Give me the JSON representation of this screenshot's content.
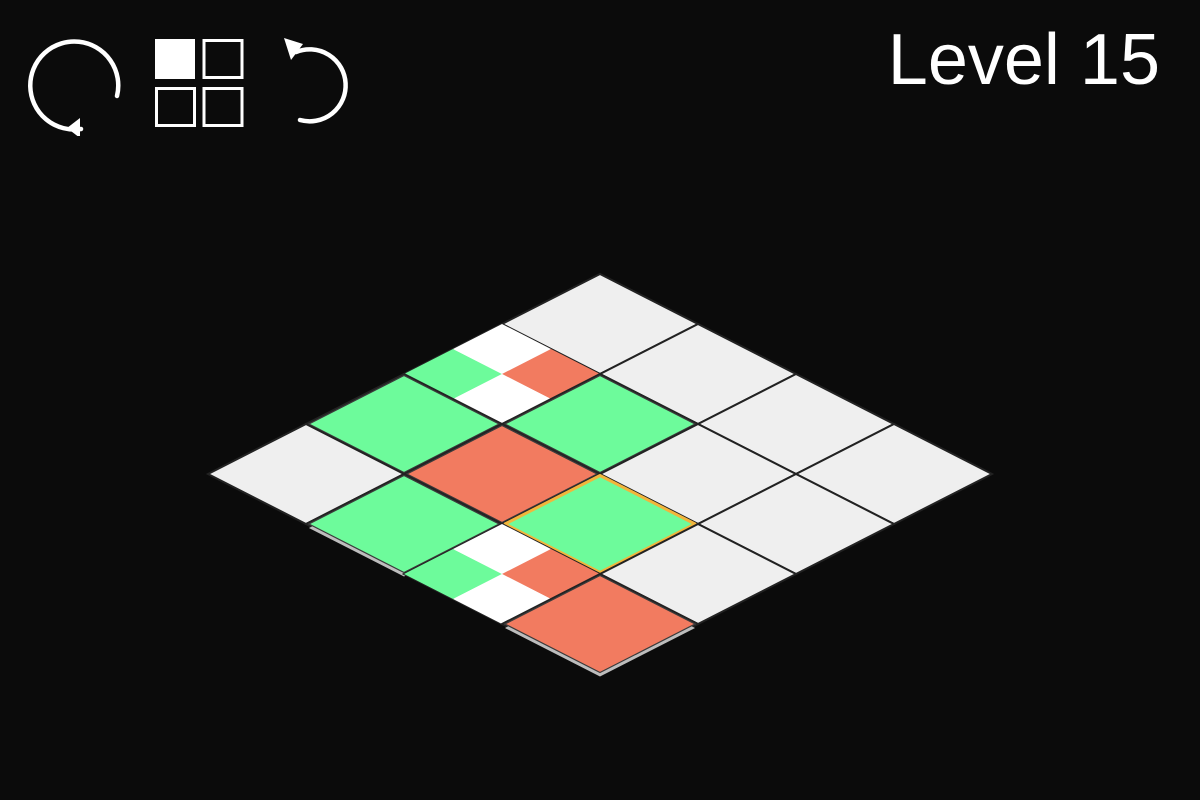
{
  "header": {
    "level_label": "Level 15"
  },
  "toolbar": {
    "restart_icon": "restart-icon",
    "levels_icon": "level-grid-icon",
    "undo_icon": "undo-icon"
  },
  "colors": {
    "background": "#0b0b0b",
    "empty_tile": "#efefef",
    "green": "#6dfb9b",
    "red": "#f27b60",
    "white": "#ffffff",
    "tile_line": "#222222",
    "selection_outline": "#f2b53c",
    "icon": "#ffffff"
  },
  "board": {
    "size": 4,
    "cells": [
      {
        "row": 0,
        "col": 0,
        "type": "empty"
      },
      {
        "row": 0,
        "col": 1,
        "type": "empty"
      },
      {
        "row": 0,
        "col": 2,
        "type": "empty"
      },
      {
        "row": 0,
        "col": 3,
        "type": "empty"
      },
      {
        "row": 1,
        "col": 0,
        "type": "split"
      },
      {
        "row": 1,
        "col": 1,
        "type": "green"
      },
      {
        "row": 1,
        "col": 2,
        "type": "empty"
      },
      {
        "row": 1,
        "col": 3,
        "type": "empty"
      },
      {
        "row": 2,
        "col": 0,
        "type": "green"
      },
      {
        "row": 2,
        "col": 1,
        "type": "red"
      },
      {
        "row": 2,
        "col": 2,
        "type": "green",
        "selected": true
      },
      {
        "row": 2,
        "col": 3,
        "type": "empty"
      },
      {
        "row": 3,
        "col": 0,
        "type": "empty"
      },
      {
        "row": 3,
        "col": 1,
        "type": "green"
      },
      {
        "row": 3,
        "col": 2,
        "type": "split"
      },
      {
        "row": 3,
        "col": 3,
        "type": "red"
      }
    ]
  }
}
